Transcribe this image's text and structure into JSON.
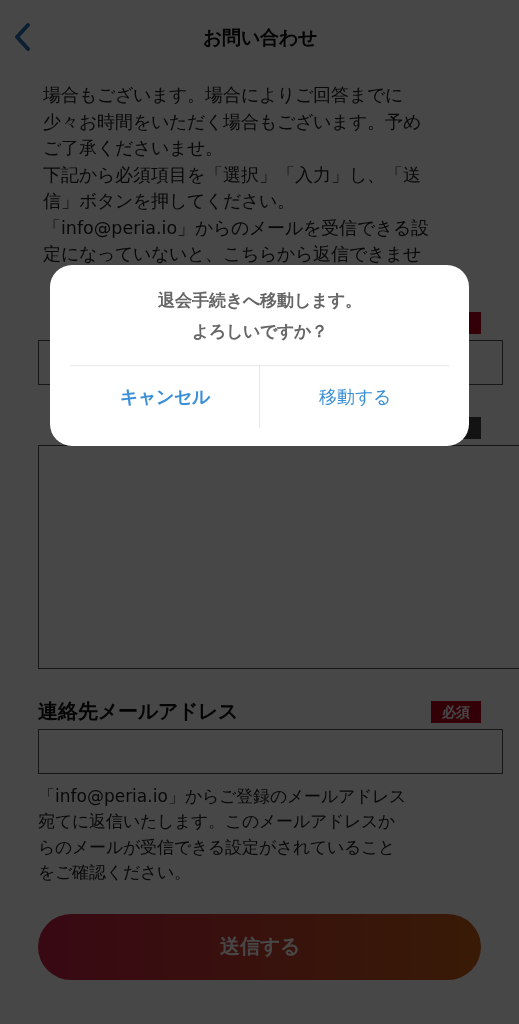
{
  "header": {
    "title": "お問い合わせ"
  },
  "intro": [
    "場合もございます。場合によりご回答までに",
    "少々お時間をいただく場合もございます。予め",
    "ご了承くださいませ。",
    "下記から必須項目を「選択」「入力」し、「送",
    "信」ボタンを押してください。",
    "「info@peria.io」からのメールを受信できる設",
    "定になっていないと、こちらから返信できませ"
  ],
  "fields": [
    {
      "kind": "input",
      "badge": {
        "kind": "required"
      }
    },
    {
      "kind": "textarea",
      "badge": {
        "kind": "optional"
      }
    },
    {
      "label": "連絡先メールアドレス",
      "kind": "input",
      "badge": {
        "kind": "required",
        "text": "必須"
      }
    }
  ],
  "email_note": [
    "「info@peria.io」からご登録のメールアドレス",
    "宛てに返信いたします。このメールアドレスか",
    "らのメールが受信できる設定がされていること",
    "をご確認ください。"
  ],
  "submit_button": {
    "label": "送信する"
  },
  "dialog": {
    "message": [
      "退会手続きへ移動します。",
      "よろしいですか？"
    ],
    "buttons": [
      {
        "label": "キャンセル",
        "kind": "cancel"
      },
      {
        "label": "移動する",
        "kind": "default"
      }
    ]
  }
}
